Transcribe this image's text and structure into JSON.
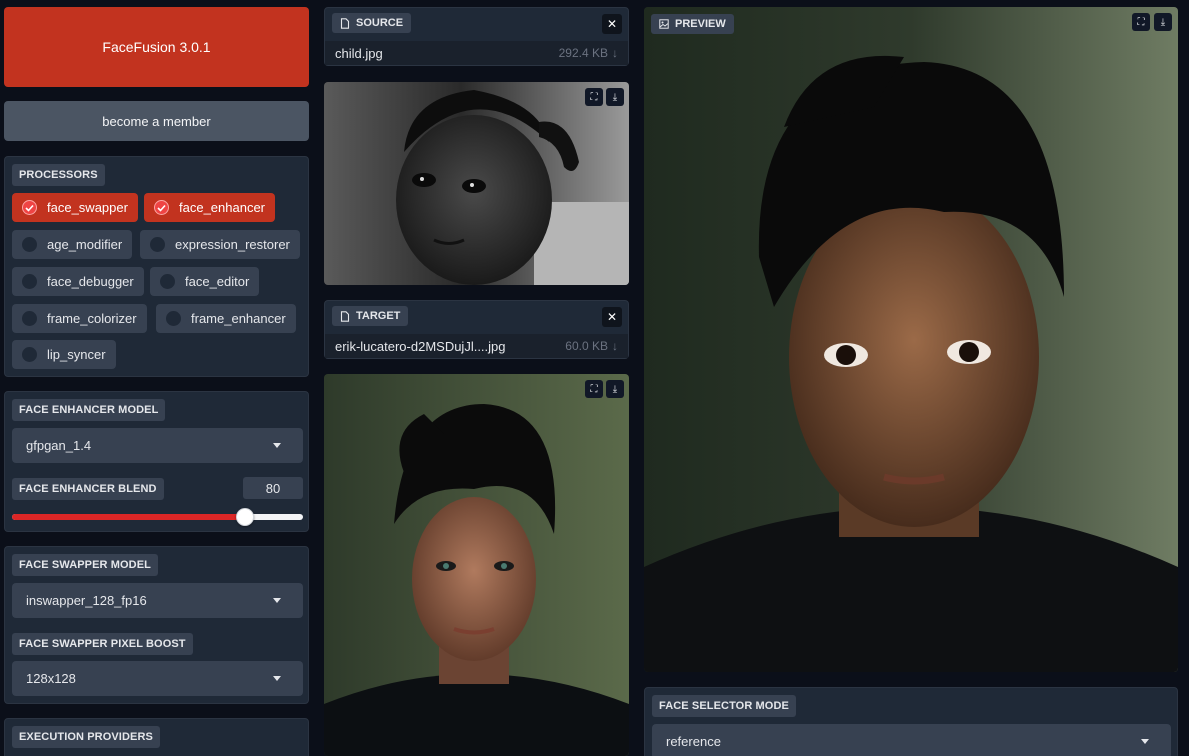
{
  "app": {
    "title_button": "FaceFusion 3.0.1",
    "member_button": "become a member"
  },
  "processors": {
    "label": "PROCESSORS",
    "items": [
      {
        "label": "face_swapper",
        "checked": true
      },
      {
        "label": "face_enhancer",
        "checked": true
      },
      {
        "label": "age_modifier",
        "checked": false
      },
      {
        "label": "expression_restorer",
        "checked": false
      },
      {
        "label": "face_debugger",
        "checked": false
      },
      {
        "label": "face_editor",
        "checked": false
      },
      {
        "label": "frame_colorizer",
        "checked": false
      },
      {
        "label": "frame_enhancer",
        "checked": false
      },
      {
        "label": "lip_syncer",
        "checked": false
      }
    ]
  },
  "face_enhancer": {
    "model_label": "FACE ENHANCER MODEL",
    "model_value": "gfpgan_1.4",
    "blend_label": "FACE ENHANCER BLEND",
    "blend_value": "80",
    "blend_fraction": 0.8
  },
  "face_swapper": {
    "model_label": "FACE SWAPPER MODEL",
    "model_value": "inswapper_128_fp16",
    "pixel_boost_label": "FACE SWAPPER PIXEL BOOST",
    "pixel_boost_value": "128x128"
  },
  "execution": {
    "label": "EXECUTION PROVIDERS"
  },
  "source": {
    "label": "SOURCE",
    "file_name": "child.jpg",
    "file_size": "292.4 KB"
  },
  "target": {
    "label": "TARGET",
    "file_name": "erik-lucatero-d2MSDujJl....jpg",
    "file_size": "60.0 KB"
  },
  "preview": {
    "label": "PREVIEW"
  },
  "face_selector": {
    "mode_label": "FACE SELECTOR MODE",
    "mode_value": "reference"
  },
  "colors": {
    "accent": "#c2331f",
    "background": "#0b0f19",
    "panel": "#1f2937",
    "chip": "#374151"
  }
}
